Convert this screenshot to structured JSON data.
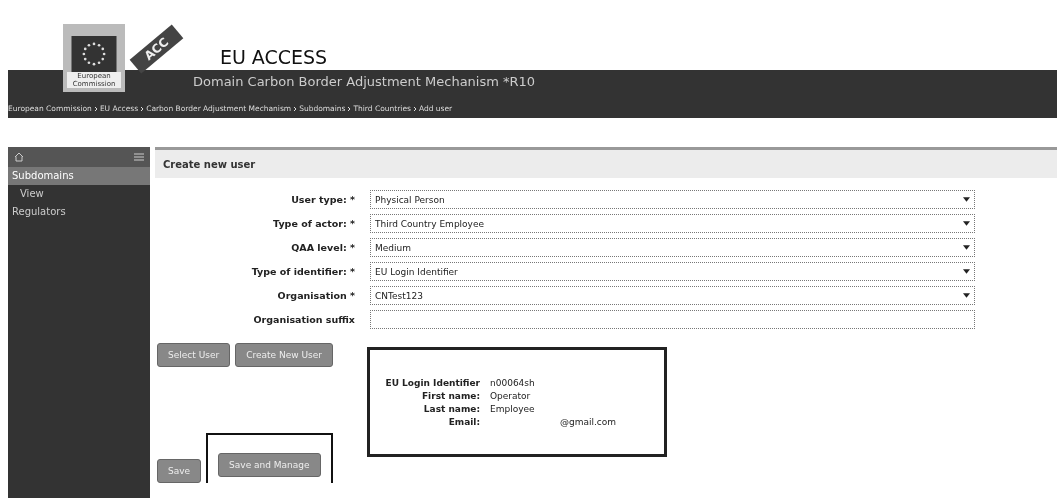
{
  "header": {
    "badge": "ACC",
    "title": "EU ACCESS",
    "logo_caption": "European Commission",
    "subtitle": "Domain Carbon Border Adjustment Mechanism *R10"
  },
  "breadcrumb": [
    "European Commission",
    "EU Access",
    "Carbon Border Adjustment Mechanism",
    "Subdomains",
    "Third Countries",
    "Add user"
  ],
  "sidebar": {
    "items": [
      {
        "label": "Subdomains",
        "selected": true,
        "children": [
          {
            "label": "View",
            "selected": false
          }
        ]
      },
      {
        "label": "Regulators",
        "selected": false
      }
    ]
  },
  "page_title": "Create new user",
  "form": [
    {
      "label": "User type: *",
      "value": "Physical Person",
      "kind": "select"
    },
    {
      "label": "Type of actor: *",
      "value": "Third Country Employee",
      "kind": "select"
    },
    {
      "label": "QAA level: *",
      "value": "Medium",
      "kind": "select"
    },
    {
      "label": "Type of identifier: *",
      "value": "EU Login Identifier",
      "kind": "select"
    },
    {
      "label": "Organisation *",
      "value": "CNTest123",
      "kind": "select"
    },
    {
      "label": "Organisation suffix",
      "kind": "text"
    }
  ],
  "action_buttons": [
    "Select User",
    "Create New User"
  ],
  "user_info": [
    {
      "label": "EU Login Identifier",
      "value": "n00064sh"
    },
    {
      "label": "First name:",
      "value": "Operator"
    },
    {
      "label": "Last name:",
      "value": "Employee"
    },
    {
      "label": "Email:",
      "value": "@gmail.com"
    }
  ],
  "footer_buttons": [
    {
      "label": "Save",
      "highlighted": false
    },
    {
      "label": "Save and Manage",
      "highlighted": true
    }
  ]
}
